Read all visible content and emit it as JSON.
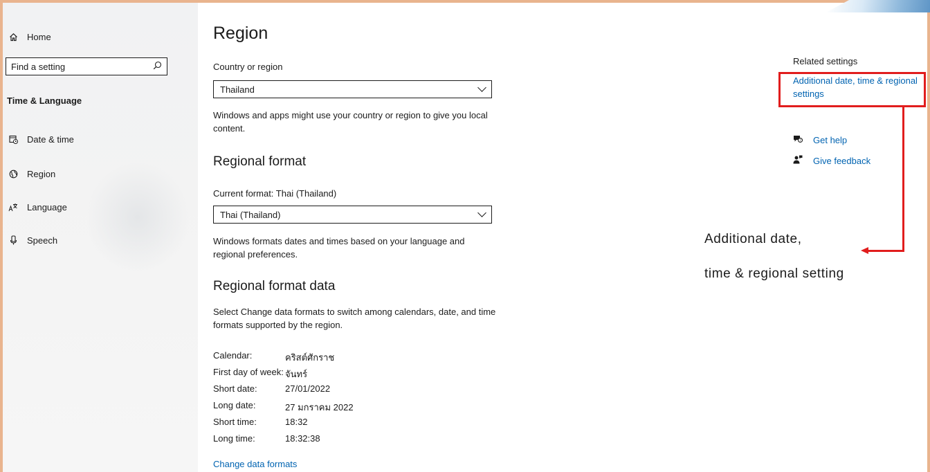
{
  "sidebar": {
    "home": "Home",
    "search_placeholder": "Find a setting",
    "section_title": "Time & Language",
    "items": [
      {
        "label": "Date & time",
        "icon": "calendar-clock-icon"
      },
      {
        "label": "Region",
        "icon": "globe-icon"
      },
      {
        "label": "Language",
        "icon": "language-icon"
      },
      {
        "label": "Speech",
        "icon": "microphone-icon"
      }
    ]
  },
  "main": {
    "title": "Region",
    "country": {
      "label": "Country or region",
      "value": "Thailand",
      "description": "Windows and apps might use your country or region to give you local content."
    },
    "regional_format": {
      "heading": "Regional format",
      "current_label": "Current format: Thai (Thailand)",
      "value": "Thai (Thailand)",
      "description": "Windows formats dates and times based on your language and regional preferences."
    },
    "format_data": {
      "heading": "Regional format data",
      "description": "Select Change data formats to switch among calendars, date, and time formats supported by the region.",
      "rows": [
        {
          "key": "Calendar:",
          "value": "คริสต์ศักราช"
        },
        {
          "key": "First day of week:",
          "value": "จันทร์"
        },
        {
          "key": "Short date:",
          "value": "27/01/2022"
        },
        {
          "key": "Long date:",
          "value": "27 มกราคม 2022"
        },
        {
          "key": "Short time:",
          "value": "18:32"
        },
        {
          "key": "Long time:",
          "value": "18:32:38"
        }
      ],
      "change_link": "Change data formats"
    }
  },
  "related": {
    "title": "Related settings",
    "link": "Additional date, time & regional settings",
    "get_help": "Get help",
    "give_feedback": "Give feedback"
  },
  "annotation": {
    "line1": "Additional date,",
    "line2": "time & regional setting",
    "color": "#e11d1d"
  }
}
